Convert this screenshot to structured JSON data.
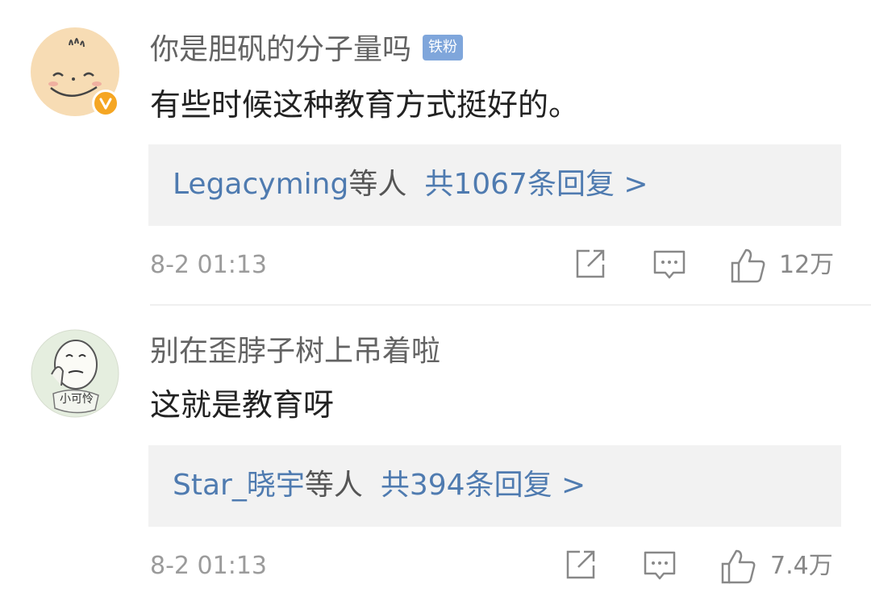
{
  "comments": [
    {
      "username": "你是胆矾的分子量吗",
      "badge": "铁粉",
      "content": "有些时候这种教育方式挺好的。",
      "replies": {
        "names": "Legacyming",
        "others": "等人",
        "count": "共1067条回复 >"
      },
      "time": "8-2 01:13",
      "likes": "12万",
      "avatar_badge_icon": "verified-v-icon"
    },
    {
      "username": "别在歪脖子树上吊着啦",
      "content": "这就是教育呀",
      "avatar_caption": "小可怜",
      "replies": {
        "names": "Star_晓宇",
        "others": "等人",
        "count": "共394条回复 >"
      },
      "time": "8-2 01:13",
      "likes": "7.4万"
    }
  ],
  "colors": {
    "link": "#4f7bb0",
    "badge": "#7fa6db",
    "verified": "#f5a623",
    "muted": "#9b9b9b"
  }
}
